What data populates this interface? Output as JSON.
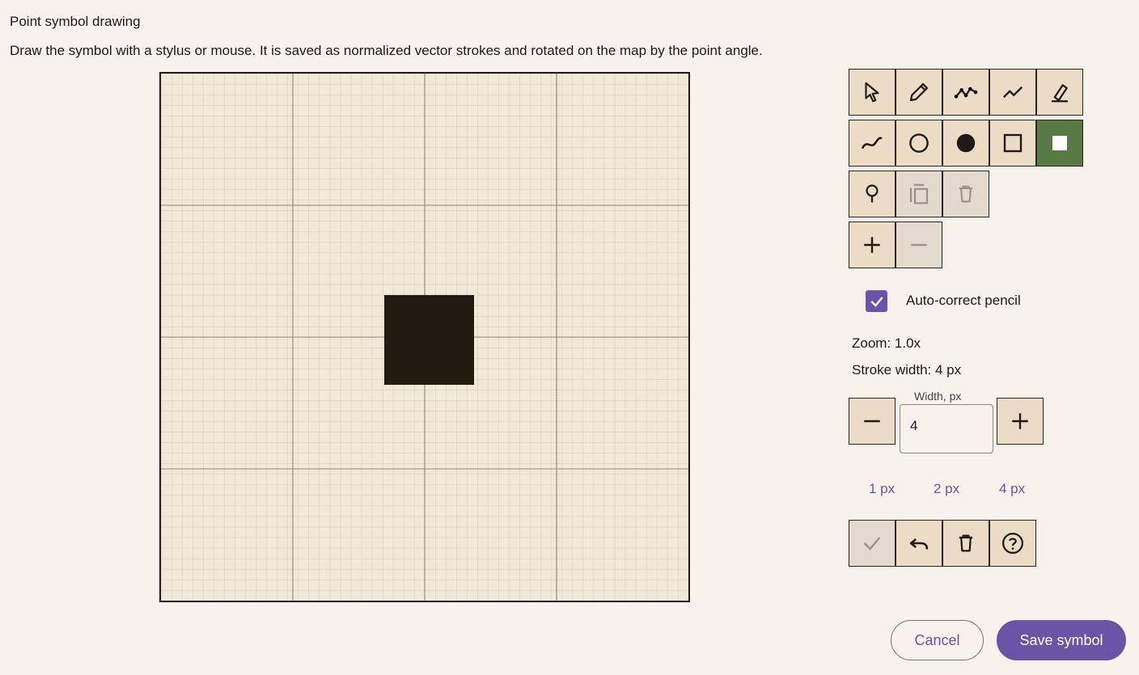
{
  "dialog": {
    "title": "Point symbol drawing",
    "description": "Draw the symbol with a stylus or mouse. It is saved as normalized vector strokes and rotated on the map by the point angle."
  },
  "toolbar": {
    "icons": [
      "select-icon",
      "pencil-icon",
      "polyline-icon",
      "line-icon",
      "eraser-icon",
      "curve-icon",
      "circle-outline-icon",
      "circle-filled-icon",
      "square-outline-icon",
      "square-filled-icon",
      "pin-icon",
      "copy-icon",
      "delete-icon",
      "plus-icon",
      "minus-icon"
    ],
    "active_tool": "square-filled-icon",
    "active_color": "#5a7a45"
  },
  "options": {
    "auto_correct_label": "Auto-correct pencil",
    "auto_correct_checked": true,
    "zoom_text": "Zoom: 1.0x",
    "stroke_text": "Stroke width: 4 px",
    "width_field_label": "Width, px",
    "width_value": "4",
    "presets": [
      "1 px",
      "2 px",
      "4 px"
    ]
  },
  "actions": {
    "cancel_label": "Cancel",
    "save_label": "Save symbol"
  },
  "colors": {
    "accent": "#6b53a6",
    "canvas": "#f2e8d9",
    "tool_bg": "#ecdcc6",
    "stroke": "#231a10"
  }
}
